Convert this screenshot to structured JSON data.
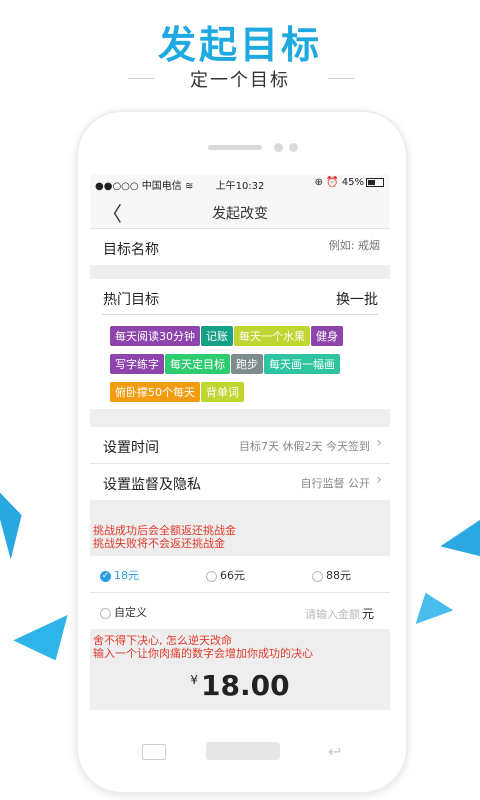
{
  "hero": {
    "title": "发起目标",
    "subtitle": "定一个目标"
  },
  "status": {
    "carrier": "●●○○○ 中国电信 ",
    "time": "上午10:32",
    "right": "⊕ ⏰ 45%"
  },
  "nav": {
    "back": "〈",
    "title": "发起改变"
  },
  "goal_name": {
    "label": "目标名称",
    "placeholder": "例如: 戒烟"
  },
  "hot": {
    "label": "热门目标",
    "swap": "换一批",
    "tags": [
      {
        "text": "每天阅读30分钟",
        "color": "#8e44ad"
      },
      {
        "text": "记账",
        "color": "#16a085"
      },
      {
        "text": "每天一个水果",
        "color": "#c0d531"
      },
      {
        "text": "健身",
        "color": "#8e44ad"
      },
      {
        "text": "写字练字",
        "color": "#8e44ad"
      },
      {
        "text": "每天定目标",
        "color": "#2ecc71"
      },
      {
        "text": "跑步",
        "color": "#7f8c8d"
      },
      {
        "text": "每天画一幅画",
        "color": "#2ec4a0"
      },
      {
        "text": "俯卧撑50个每天",
        "color": "#f39c12"
      },
      {
        "text": "背单词",
        "color": "#c0d531"
      }
    ]
  },
  "time": {
    "label": "设置时间",
    "value": "目标7天 休假2天 今天签到"
  },
  "privacy": {
    "label": "设置监督及隐私",
    "value": "自行监督 公开"
  },
  "notice1": {
    "line1": "挑战成功后会全额返还挑战金",
    "line2": "挑战失败将不会返还挑战金"
  },
  "amount_options": [
    {
      "label": "18元",
      "selected": true
    },
    {
      "label": "66元",
      "selected": false
    },
    {
      "label": "88元",
      "selected": false
    }
  ],
  "custom": {
    "label": "自定义",
    "placeholder": "请输入金额",
    "unit": "元"
  },
  "notice2": {
    "line1": "舍不得下决心, 怎么逆天改命",
    "line2": "输入一个让你肉痛的数字会增加你成功的决心"
  },
  "total": {
    "currency": "¥",
    "value": "18.00"
  }
}
